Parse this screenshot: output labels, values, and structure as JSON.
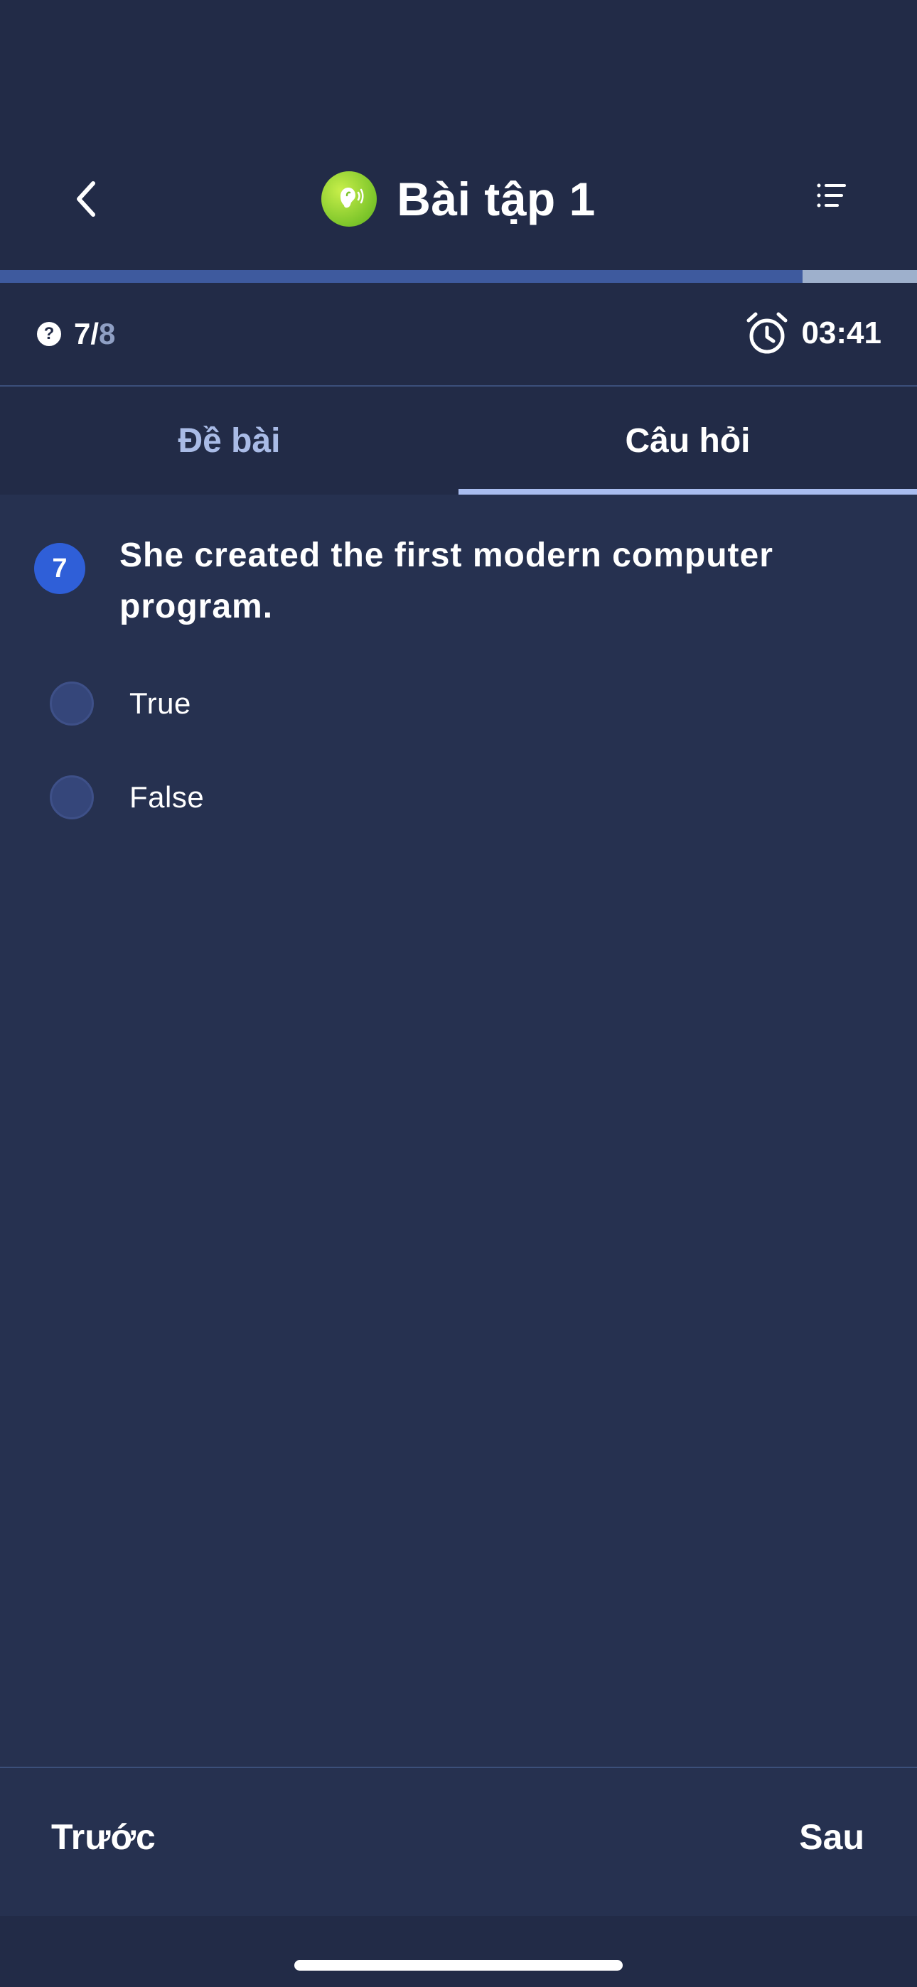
{
  "header": {
    "title": "Bài tập 1",
    "icon": "ear-listening-icon",
    "back_icon": "chevron-left-icon",
    "menu_icon": "list-icon"
  },
  "progress": {
    "fraction": 0.875
  },
  "status": {
    "current": "7",
    "separator": "/",
    "total": "8",
    "timer": "03:41"
  },
  "tabs": [
    {
      "label": "Đề bài",
      "active": false
    },
    {
      "label": "Câu hỏi",
      "active": true
    }
  ],
  "question": {
    "number": "7",
    "text": "She created the first modern computer program.",
    "options": [
      {
        "label": "True",
        "selected": false
      },
      {
        "label": "False",
        "selected": false
      }
    ]
  },
  "footer": {
    "prev_label": "Trước",
    "next_label": "Sau"
  },
  "colors": {
    "background": "#263150",
    "header": "#222b47",
    "accent": "#2f5fd8",
    "tab_inactive": "#a9bbe6",
    "icon_green": "#7cc52a"
  }
}
